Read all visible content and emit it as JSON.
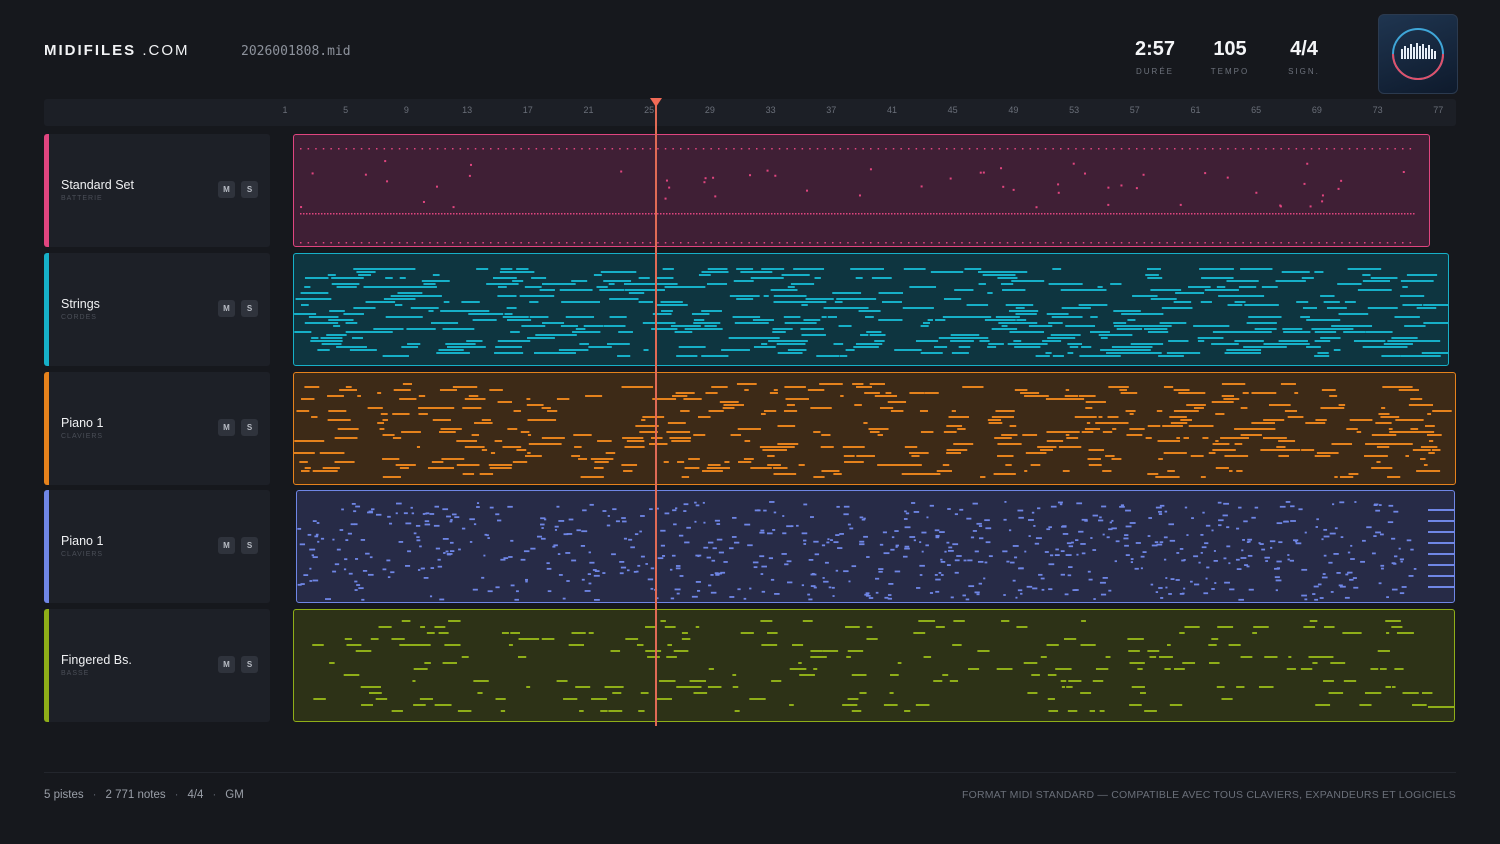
{
  "app": {
    "logo_bold": "MIDIFILES",
    "logo_light": ".COM",
    "filename": "2026001808.mid"
  },
  "stats": [
    {
      "value": "2:57",
      "label": "DURÉE"
    },
    {
      "value": "105",
      "label": "TEMPO"
    },
    {
      "value": "4/4",
      "label": "SIGN."
    }
  ],
  "ruler": {
    "ticks": [
      "1",
      "5",
      "9",
      "13",
      "17",
      "21",
      "25",
      "29",
      "33",
      "37",
      "41",
      "45",
      "49",
      "53",
      "57",
      "61",
      "65",
      "69",
      "73",
      "77"
    ]
  },
  "tracks": [
    {
      "name": "Standard Set",
      "category": "BATTERIE",
      "color": "#e0457f",
      "fill": "#3f1f35",
      "mute_label": "M",
      "solo_label": "S"
    },
    {
      "name": "Strings",
      "category": "CORDES",
      "color": "#16b0c8",
      "fill": "#0e3540",
      "mute_label": "M",
      "solo_label": "S"
    },
    {
      "name": "Piano 1",
      "category": "CLAVIERS",
      "color": "#e6821c",
      "fill": "#3d2a17",
      "mute_label": "M",
      "solo_label": "S"
    },
    {
      "name": "Piano 1",
      "category": "CLAVIERS",
      "color": "#6f86e6",
      "fill": "#272b47",
      "mute_label": "M",
      "solo_label": "S"
    },
    {
      "name": "Fingered Bs.",
      "category": "BASSE",
      "color": "#8fae18",
      "fill": "#2d3217",
      "mute_label": "M",
      "solo_label": "S"
    }
  ],
  "footer": {
    "tracks_count": "5 pistes",
    "notes_count": "2 771 notes",
    "signature": "4/4",
    "standard": "GM",
    "tagline": "FORMAT MIDI STANDARD — COMPATIBLE AVEC TOUS CLAVIERS, EXPANDEURS ET LOGICIELS"
  }
}
